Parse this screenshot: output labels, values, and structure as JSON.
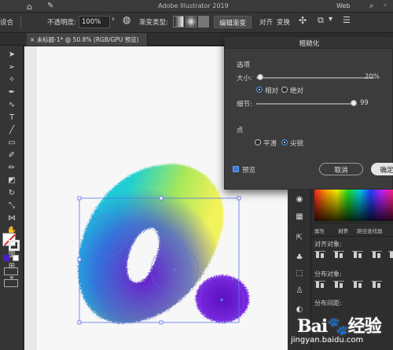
{
  "titlebar": {
    "title": "Adobe Illustrator 2019",
    "workspace": "Web",
    "home_icon": "⌂",
    "pen_icon": "✎",
    "search_icon": "⌕"
  },
  "controlbar": {
    "left_label": "设合",
    "opacity_label": "不透明度:",
    "opacity_value": "100%",
    "gradient_type_label": "渐变类型:",
    "edit_gradient": "编辑渐变",
    "align": "对齐",
    "transform": "变换"
  },
  "doc_tab": {
    "label": "未标题-1* @ 50.8% (RGB/GPU 预览)",
    "close": "×"
  },
  "dialog": {
    "title": "粗糙化",
    "options_label": "选项",
    "size_label": "大小:",
    "size_value": "20%",
    "size_fraction": 0.03,
    "relative_label": "相对",
    "absolute_label": "绝对",
    "detail_label": "细节:",
    "detail_value": "99",
    "detail_fraction": 0.97,
    "points_label": "点",
    "smooth_label": "平滑",
    "corner_label": "尖锐",
    "preview_label": "预览",
    "cancel_label": "取消",
    "ok_label": "确定"
  },
  "right_panel": {
    "tabs": [
      "属性",
      "对齐",
      "路径查找器"
    ],
    "align_objects": "对齐对象:",
    "distribute_objects": "分布对象:",
    "distribute_spacing": "分布间距:"
  },
  "watermark": {
    "logo_text": "Bai🐾经验",
    "url": "jingyan.baidu.com"
  },
  "colors": {
    "ui_dark": "#2b2b2b",
    "artboard": "#f7f7f7",
    "selection_blue": "#4b6fe0",
    "dialog_bg": "#3c3c3c"
  }
}
